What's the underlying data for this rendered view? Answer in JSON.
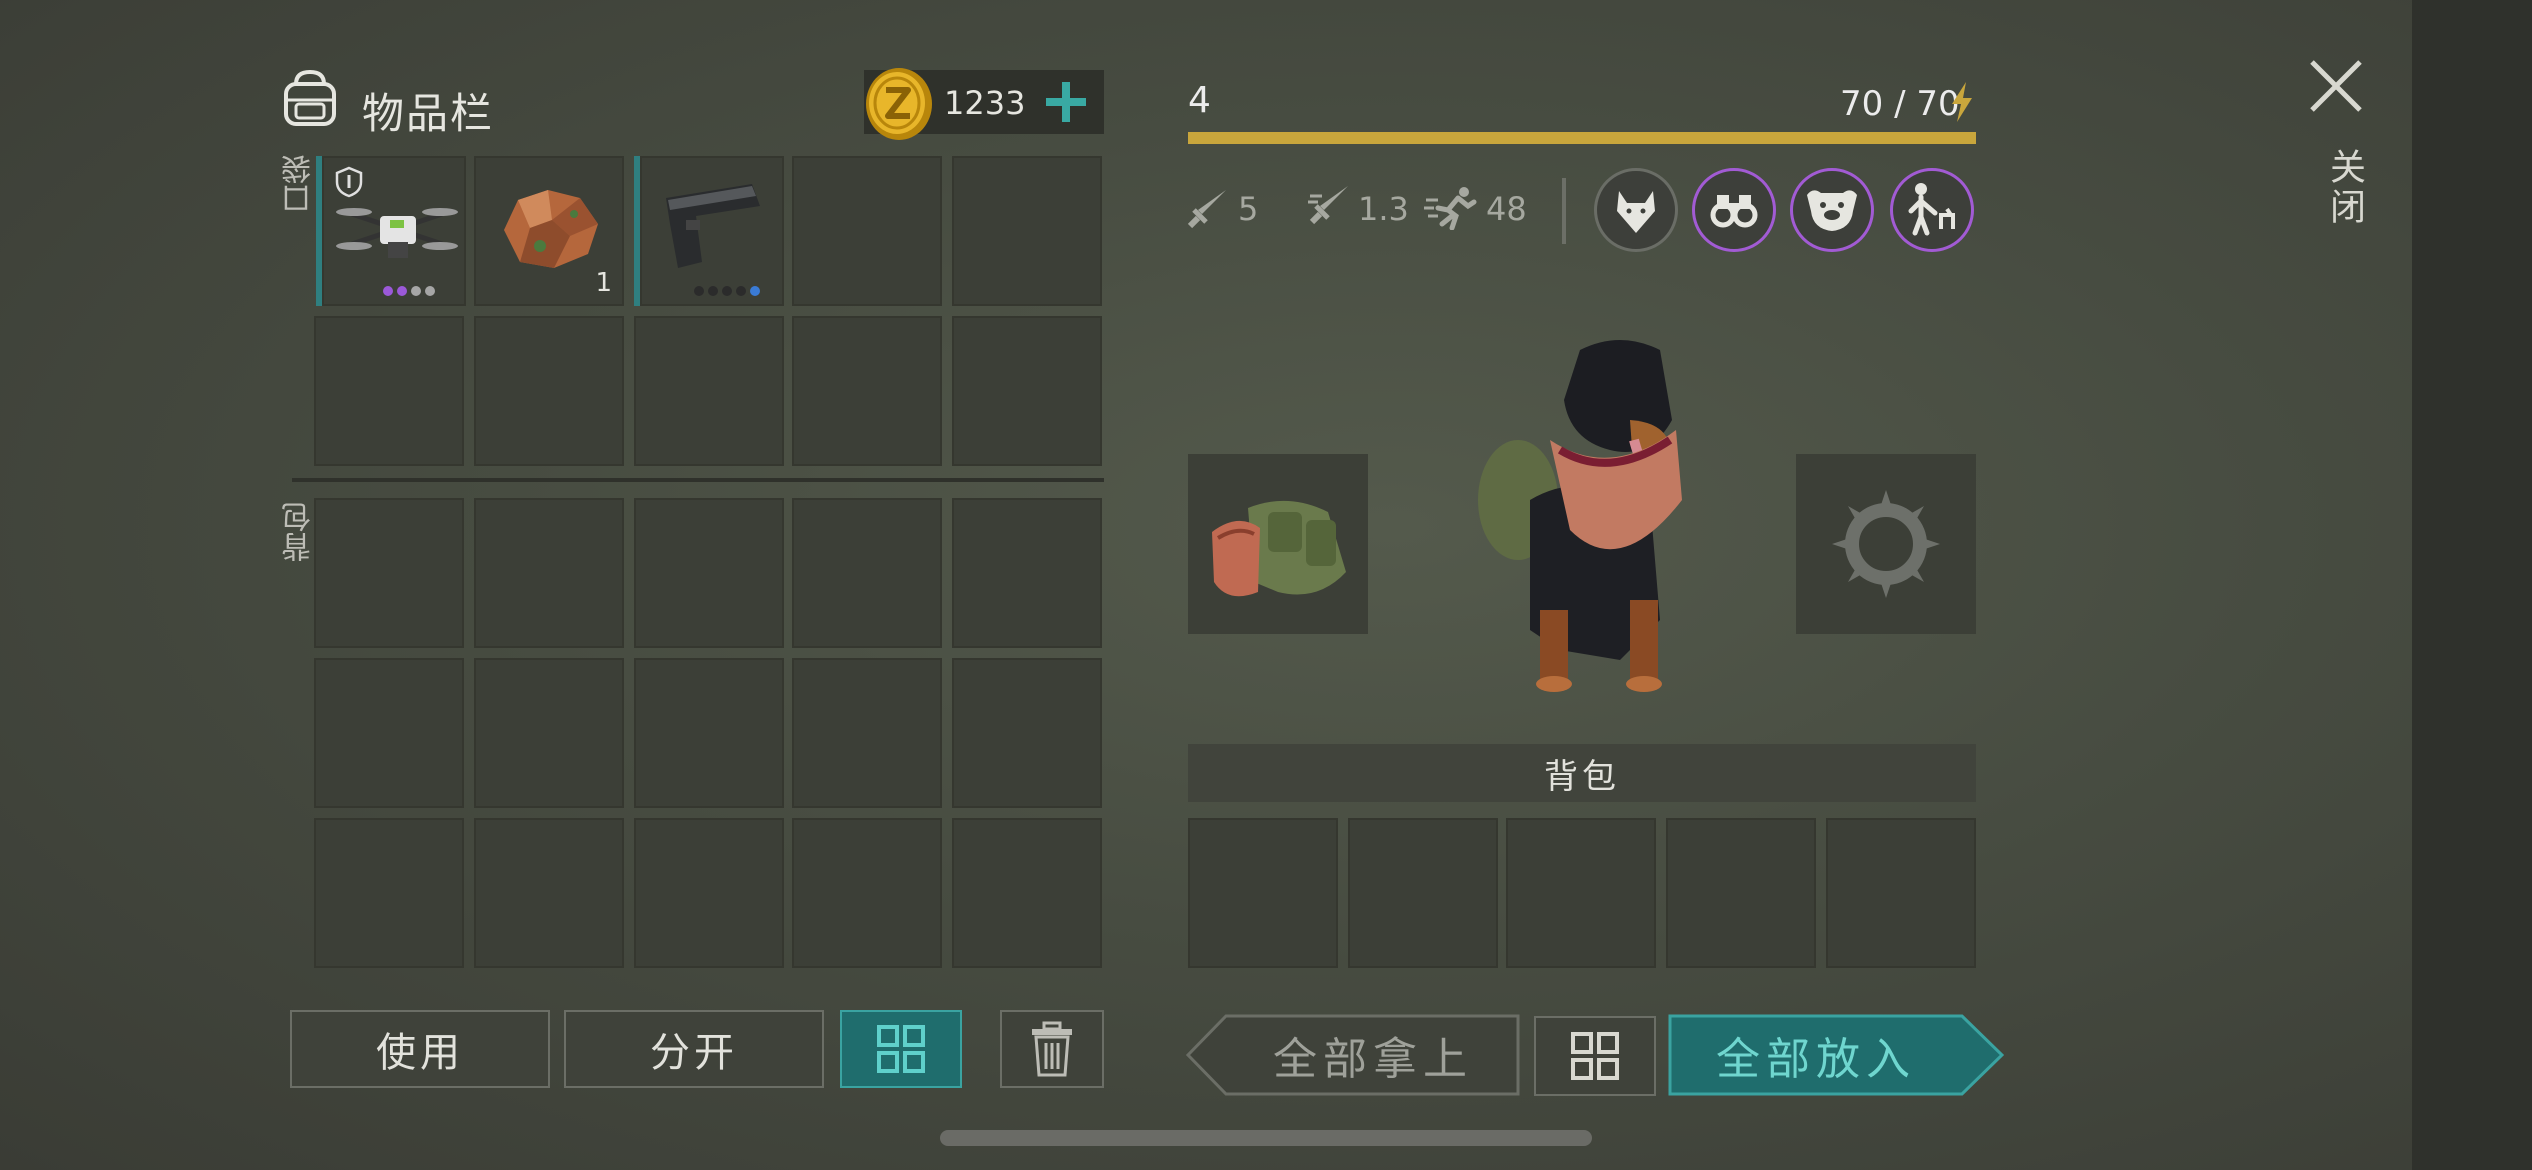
{
  "inventory": {
    "title": "物品栏",
    "coins": "1233",
    "pocket_label": "口袋",
    "backpack_label": "背包",
    "pocket_items": [
      {
        "name": "drone",
        "icon": "drone-icon",
        "quality_dots": [
          "#9b59d9",
          "#9b59d9",
          "#a6a6a6",
          "#a6a6a6"
        ]
      },
      {
        "name": "ore",
        "icon": "copper-ore-icon",
        "quantity": "1"
      },
      {
        "name": "pistol",
        "icon": "pistol-icon",
        "quality_dots": [
          "#2b2b2b",
          "#2b2b2b",
          "#2b2b2b",
          "#2b2b2b",
          "#3a7bd5"
        ]
      }
    ],
    "buttons": {
      "use": "使用",
      "split": "分开"
    }
  },
  "dog": {
    "level": "4",
    "energy": "70 / 70",
    "energy_fraction": 1.0,
    "stats": {
      "attack": "5",
      "attack_speed": "1.3",
      "speed": "48"
    },
    "skills": [
      "wolf-skill-icon",
      "binoculars-skill-icon",
      "dog-face-skill-icon",
      "trainer-skill-icon"
    ],
    "backpack_header": "背包",
    "buttons": {
      "take_all": "全部拿上",
      "put_all": "全部放入"
    }
  },
  "close_label": "关闭",
  "colors": {
    "accent_teal": "#1f6d6d",
    "energy_gold": "#c9a63c",
    "skill_purple": "#a25bd4"
  }
}
